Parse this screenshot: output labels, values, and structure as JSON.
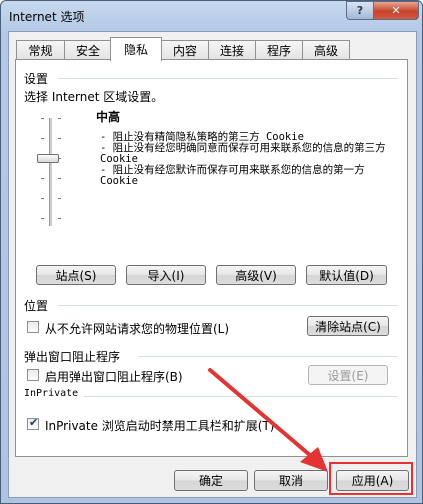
{
  "window": {
    "title": "Internet 选项",
    "help": "?",
    "close": "✕"
  },
  "tabs": [
    "常规",
    "安全",
    "隐私",
    "内容",
    "连接",
    "程序",
    "高级"
  ],
  "settings": {
    "heading": "设置",
    "instruction": "选择 Internet 区域设置。",
    "level": "中高",
    "descriptions": [
      "- 阻止没有精简隐私策略的第三方 Cookie",
      "- 阻止没有经您明确同意而保存可用来联系您的信息的第三方 Cookie",
      "- 阻止没有经您默许而保存可用来联系您的信息的第一方 Cookie"
    ],
    "buttons": [
      "站点(S)",
      "导入(I)",
      "高级(V)",
      "默认值(D)"
    ]
  },
  "location": {
    "heading": "位置",
    "checkbox": "从不允许网站请求您的物理位置(L)",
    "checked": false,
    "clear_button": "清除站点(C)"
  },
  "popup": {
    "heading": "弹出窗口阻止程序",
    "checkbox": "启用弹出窗口阻止程序(B)",
    "checked": false,
    "settings_button": "设置(E)"
  },
  "inprivate": {
    "heading": "InPrivate",
    "checkbox": "InPrivate 浏览启动时禁用工具栏和扩展(T)",
    "checked": true
  },
  "footer": {
    "ok": "确定",
    "cancel": "取消",
    "apply": "应用(A)"
  },
  "colors": {
    "annotation": "#e53333"
  }
}
